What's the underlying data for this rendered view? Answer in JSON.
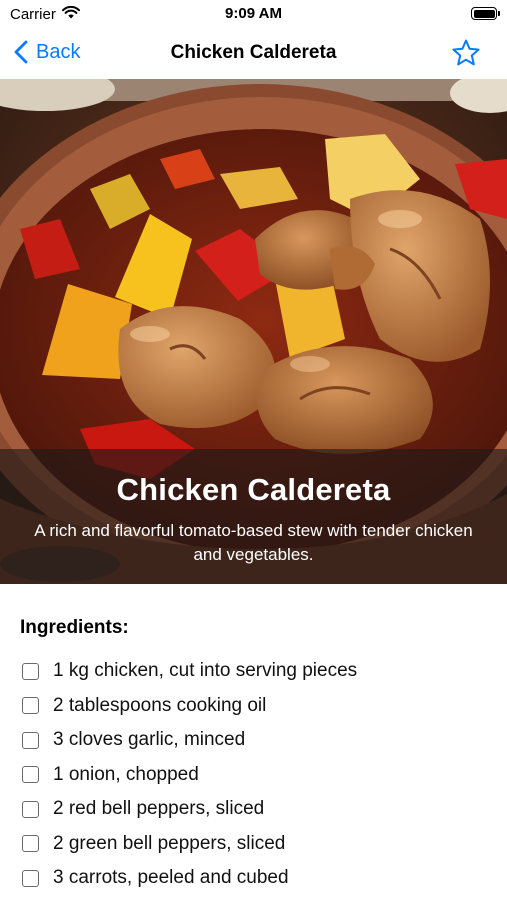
{
  "status_bar": {
    "carrier": "Carrier",
    "time": "9:09 AM",
    "icons": [
      "wifi-icon",
      "battery-icon"
    ]
  },
  "nav": {
    "back_label": "Back",
    "title": "Chicken Caldereta",
    "back_icon": "chevron-left-icon",
    "favorite_icon": "star-icon"
  },
  "hero": {
    "title": "Chicken Caldereta",
    "description": "A rich and flavorful tomato-based stew with tender chicken and vegetables."
  },
  "ingredients": {
    "heading": "Ingredients:",
    "items": [
      "1 kg chicken, cut into serving pieces",
      "2 tablespoons cooking oil",
      "3 cloves garlic, minced",
      "1 onion, chopped",
      "2 red bell peppers, sliced",
      "2 green bell peppers, sliced",
      "3 carrots, peeled and cubed"
    ]
  },
  "colors": {
    "accent": "#0a7aff",
    "overlay": "#1e1816"
  }
}
